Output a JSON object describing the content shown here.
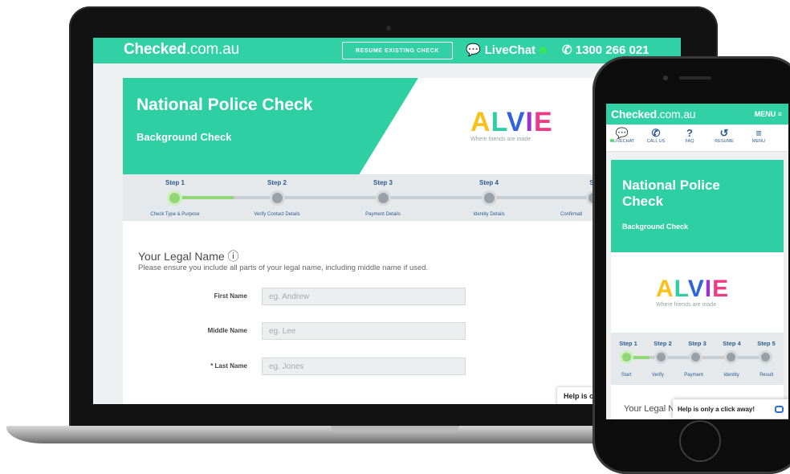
{
  "brand": {
    "logo_bold": "Checked",
    "logo_thin": ".com.au"
  },
  "desktop": {
    "header": {
      "resume_label": "RESUME EXISTING CHECK",
      "livechat_label": "LiveChat",
      "phone": "1300 266 021"
    },
    "hero": {
      "title": "National Police Check",
      "subtitle": "Background Check"
    },
    "partner": {
      "name": "ALVIE",
      "tagline": "Where friends are made"
    },
    "steps": [
      {
        "label": "Step 1",
        "desc": "Check Type & Purpose"
      },
      {
        "label": "Step 2",
        "desc": "Verify Contact Details"
      },
      {
        "label": "Step 3",
        "desc": "Payment Details"
      },
      {
        "label": "Step 4",
        "desc": "Identity Details"
      },
      {
        "label": "Step",
        "desc": "Confirmati"
      }
    ],
    "form": {
      "title": "Your Legal Name ⓘ",
      "description": "Please ensure you include all parts of your legal name, including middle name if used.",
      "fields": [
        {
          "label": "First Name",
          "placeholder": "eg. Andrew"
        },
        {
          "label": "Middle Name",
          "placeholder": "eg. Lee"
        },
        {
          "label": "* Last Name",
          "placeholder": "eg. Jones"
        }
      ]
    },
    "help_text": "Help is or"
  },
  "mobile": {
    "menu_label": "MENU ≡",
    "icons": [
      {
        "glyph": "💬",
        "label": "LIVECHAT"
      },
      {
        "glyph": "✆",
        "label": "CALL US"
      },
      {
        "glyph": "?",
        "label": "FAQ"
      },
      {
        "glyph": "↺",
        "label": "RESUME"
      },
      {
        "glyph": "≡",
        "label": "MENU"
      }
    ],
    "hero": {
      "title": "National Police Check",
      "subtitle": "Background Check"
    },
    "steps": [
      {
        "label": "Step 1",
        "desc": "Start"
      },
      {
        "label": "Step 2",
        "desc": "Verify"
      },
      {
        "label": "Step 3",
        "desc": "Payment"
      },
      {
        "label": "Step 4",
        "desc": "Identity"
      },
      {
        "label": "Step 5",
        "desc": "Result"
      }
    ],
    "form_title_partial": "Your Legal N",
    "help_text": "Help is only a click away!"
  },
  "colors": {
    "brand_green": "#32d1a5",
    "step_blue": "#2d5c8e",
    "active_step": "#92d775",
    "online_dot": "#3ee35a"
  }
}
